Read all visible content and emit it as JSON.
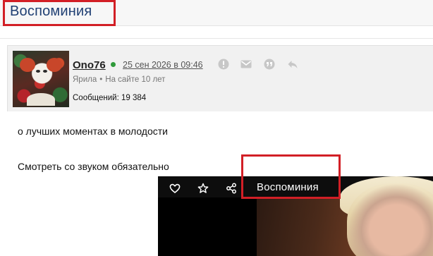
{
  "page": {
    "title": "Воспоминия"
  },
  "post": {
    "username": "Ono76",
    "date": "25 сен 2026 в 09:46",
    "location": "Ярила",
    "site_age": "На сайте 10 лет",
    "messages": "Сообщений: 19 384",
    "lines": [
      "о лучших моментах в молодости",
      "Смотреть со звуком обязательно"
    ]
  },
  "post_actions": [
    "alert-icon",
    "mail-icon",
    "quote-icon",
    "reply-icon"
  ],
  "video": {
    "title": "Воспоминия",
    "controls": [
      "heart-icon",
      "star-icon",
      "share-icon"
    ]
  },
  "colors": {
    "title": "#1f3f73",
    "highlight": "#d21f26",
    "online": "#2f9a3a",
    "header_bg": "#f1f1f1"
  }
}
